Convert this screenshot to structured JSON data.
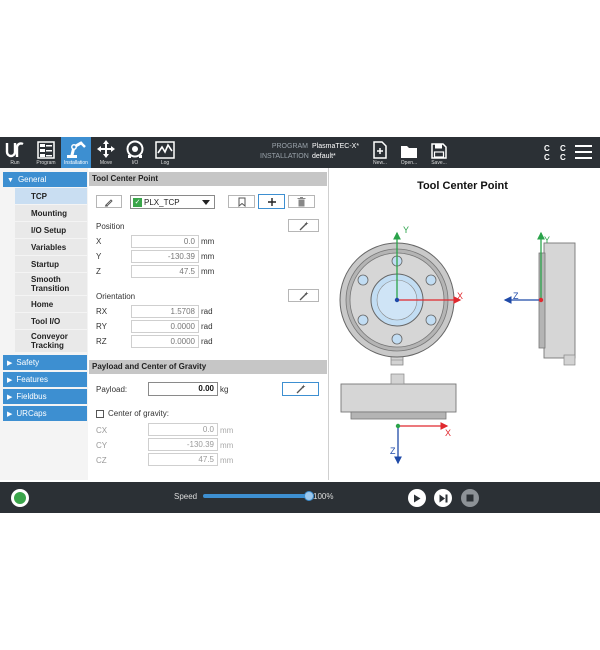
{
  "topbar": {
    "buttons": [
      {
        "label": "Run",
        "icon": "ur-logo-icon"
      },
      {
        "label": "Program",
        "icon": "program-icon"
      },
      {
        "label": "Installation",
        "icon": "installation-icon",
        "active": true
      },
      {
        "label": "Move",
        "icon": "move-icon"
      },
      {
        "label": "I/O",
        "icon": "io-icon"
      },
      {
        "label": "Log",
        "icon": "log-icon"
      }
    ],
    "program_label": "PROGRAM",
    "program_value": "PlasmaTEC-X*",
    "installation_label": "INSTALLATION",
    "installation_value": "default*",
    "file_buttons": [
      {
        "label": "New...",
        "icon": "new-file-icon"
      },
      {
        "label": "Open...",
        "icon": "open-folder-icon"
      },
      {
        "label": "Save...",
        "icon": "save-icon"
      }
    ],
    "cc_row1": "C C",
    "cc_row2": "C C"
  },
  "leftnav": {
    "general": "General",
    "general_items": [
      "TCP",
      "Mounting",
      "I/O Setup",
      "Variables",
      "Startup",
      "Smooth Transition",
      "Home",
      "Tool I/O",
      "Conveyor Tracking"
    ],
    "selected": "TCP",
    "categories": [
      "Safety",
      "Features",
      "Fieldbus",
      "URCaps"
    ]
  },
  "tcp_panel": {
    "header": "Tool Center Point",
    "selected_tcp": "PLX_TCP",
    "position_label": "Position",
    "position": [
      {
        "axis": "X",
        "value": "0.0",
        "unit": "mm"
      },
      {
        "axis": "Y",
        "value": "-130.39",
        "unit": "mm"
      },
      {
        "axis": "Z",
        "value": "47.5",
        "unit": "mm"
      }
    ],
    "orientation_label": "Orientation",
    "orientation": [
      {
        "axis": "RX",
        "value": "1.5708",
        "unit": "rad"
      },
      {
        "axis": "RY",
        "value": "0.0000",
        "unit": "rad"
      },
      {
        "axis": "RZ",
        "value": "0.0000",
        "unit": "rad"
      }
    ]
  },
  "payload_panel": {
    "header": "Payload and Center of Gravity",
    "payload_label": "Payload:",
    "payload_value": "0.00",
    "payload_unit": "kg",
    "cog_label": "Center of gravity:",
    "cog": [
      {
        "axis": "CX",
        "value": "0.0",
        "unit": "mm"
      },
      {
        "axis": "CY",
        "value": "-130.39",
        "unit": "mm"
      },
      {
        "axis": "CZ",
        "value": "47.5",
        "unit": "mm"
      }
    ]
  },
  "viz": {
    "title": "Tool Center Point",
    "axis_x": "X",
    "axis_y": "Y",
    "axis_z": "Z",
    "color_x": "#e0282e",
    "color_y": "#2aa34a",
    "color_z": "#1f4aa8"
  },
  "bottombar": {
    "speed_label": "Speed",
    "speed_value": "100%",
    "speed_fraction": 1.0,
    "power_color": "#3aa54a"
  }
}
